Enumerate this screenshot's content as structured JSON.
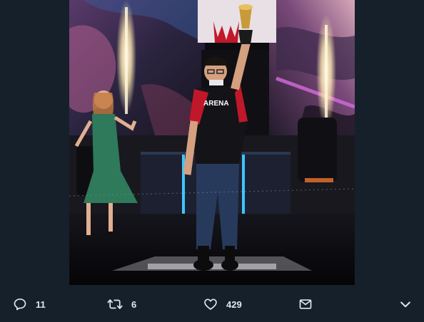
{
  "photo": {
    "description_icon": "photo-media"
  },
  "actions": {
    "reply": {
      "icon": "reply-icon",
      "count": "11"
    },
    "retweet": {
      "icon": "retweet-icon",
      "count": "6"
    },
    "like": {
      "icon": "heart-icon",
      "count": "429"
    },
    "message": {
      "icon": "envelope-icon"
    },
    "more": {
      "icon": "chevron-down-icon"
    }
  },
  "colors": {
    "background": "#15202b",
    "icon": "#e1e8ed",
    "stage_cyan": "#3ec6ff",
    "dress_green": "#2e7a5a",
    "jersey_red": "#c0182a"
  }
}
